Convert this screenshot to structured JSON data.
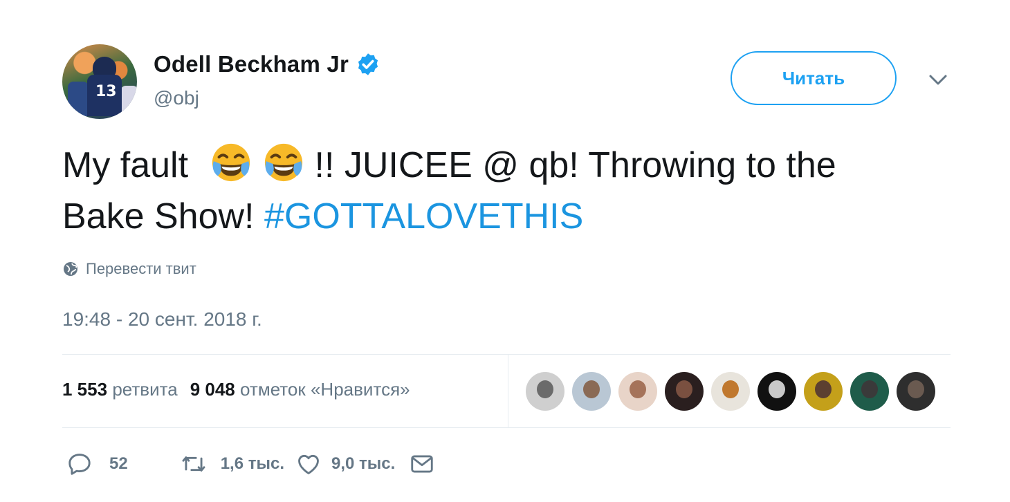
{
  "author": {
    "display_name": "Odell Beckham Jr",
    "handle": "@obj",
    "avatar_icon": "profile-photo-football-player",
    "verified_icon": "verified-badge-icon",
    "jersey_number": "13"
  },
  "follow_button": {
    "label": "Читать"
  },
  "menu": {
    "icon": "chevron-down-icon"
  },
  "tweet": {
    "text_before_emoji": "My fault",
    "emoji_name": "face-with-tears-of-joy",
    "text_after_emoji": "!! JUICEE @ qb! Throwing to the Bake Show! ",
    "hashtag": "#GOTTALOVETHIS"
  },
  "translate": {
    "label": "Перевести твит",
    "icon": "globe-icon"
  },
  "timestamp": "19:48 - 20 сент. 2018 г.",
  "stats": {
    "retweets_count": "1 553",
    "retweets_label": "ретвита",
    "likes_count": "9 048",
    "likes_label": "отметок «Нравится»"
  },
  "likers": [
    {
      "bg": "#cfcfcf",
      "fg": "#6b6b6b"
    },
    {
      "bg": "#b9c7d4",
      "fg": "#8a6a55"
    },
    {
      "bg": "#e8d4c8",
      "fg": "#a5735a"
    },
    {
      "bg": "#2a1f1f",
      "fg": "#7a5040"
    },
    {
      "bg": "#e8e4dc",
      "fg": "#c0782e"
    },
    {
      "bg": "#111111",
      "fg": "#c9c9c9"
    },
    {
      "bg": "#c4a01a",
      "fg": "#5c4030"
    },
    {
      "bg": "#1f5c4a",
      "fg": "#3a3a3a"
    },
    {
      "bg": "#2e2e2e",
      "fg": "#6a5a50"
    }
  ],
  "actions": {
    "reply_count": "52",
    "retweet_count": "1,6 тыс.",
    "like_count": "9,0 тыс.",
    "reply_icon": "reply-icon",
    "retweet_icon": "retweet-icon",
    "like_icon": "heart-icon",
    "dm_icon": "envelope-icon"
  },
  "colors": {
    "accent": "#1da1f2",
    "hashtag": "#1b95e0",
    "secondary_text": "#657786",
    "primary_text": "#14171a",
    "emoji_yellow": "#f7b928",
    "emoji_tears": "#5dadec"
  }
}
